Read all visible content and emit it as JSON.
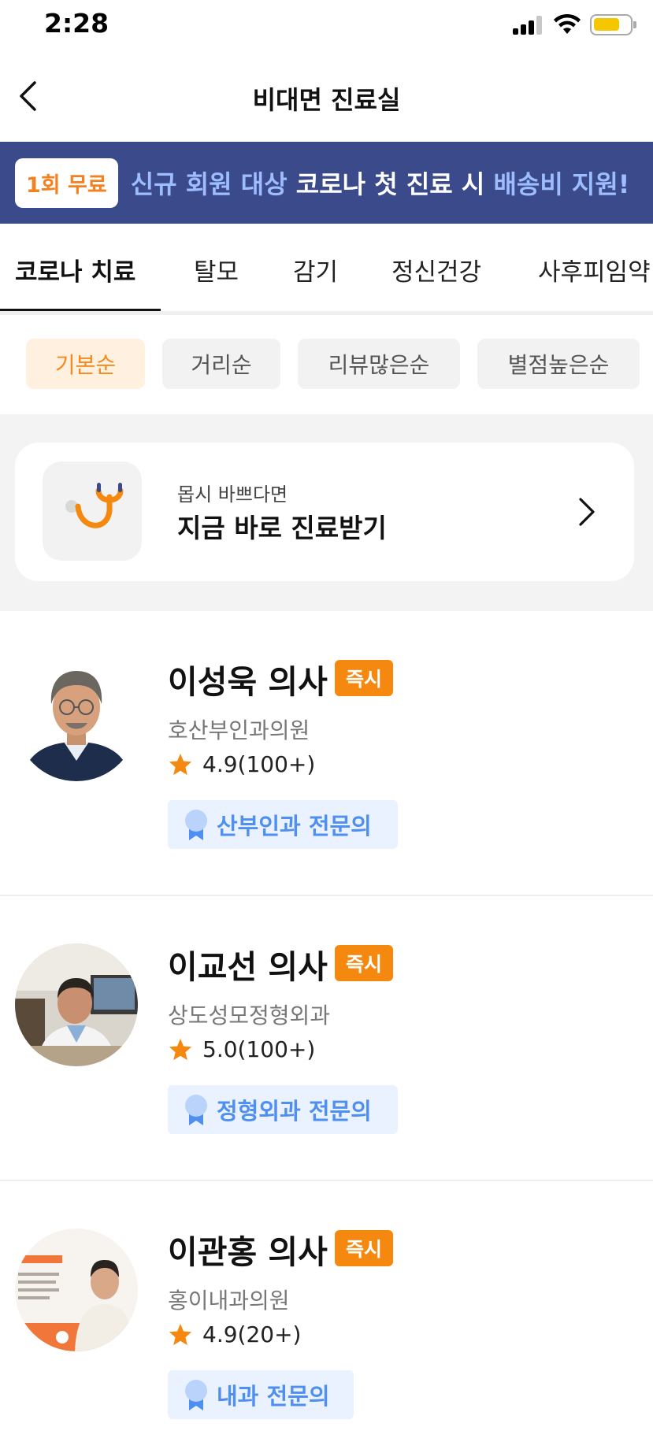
{
  "status_bar": {
    "time": "2:28"
  },
  "header": {
    "title": "비대면 진료실"
  },
  "banner": {
    "badge": "1회 무료",
    "text_part1": "신규 회원 대상 ",
    "text_part2": "코로나 첫 진료 시 ",
    "text_part3": "배송비 지원!"
  },
  "tabs": [
    "코로나 치료",
    "탈모",
    "감기",
    "정신건강",
    "사후피임약"
  ],
  "active_tab": "코로나 치료",
  "sort_options": [
    "기본순",
    "거리순",
    "리뷰많은순",
    "별점높은순"
  ],
  "active_sort": "기본순",
  "quick_consult": {
    "subtitle": "몹시 바쁘다면",
    "title": "지금 바로 진료받기"
  },
  "doctors": [
    {
      "name": "이성욱 의사",
      "badge": "즉시",
      "clinic": "호산부인과의원",
      "rating": "4.9(100+)",
      "specialty": "산부인과 전문의"
    },
    {
      "name": "이교선 의사",
      "badge": "즉시",
      "clinic": "상도성모정형외과",
      "rating": "5.0(100+)",
      "specialty": "정형외과 전문의"
    },
    {
      "name": "이관홍 의사",
      "badge": "즉시",
      "clinic": "홍이내과의원",
      "rating": "4.9(20+)",
      "specialty": "내과 전문의"
    }
  ],
  "colors": {
    "accent": "#f5880f",
    "banner_bg": "#3a4a8a",
    "banner_highlight": "#9dbdff",
    "specialty_text": "#4e8ff0",
    "specialty_bg": "#ebf2ff",
    "active_chip_bg": "#fff0df"
  },
  "icons": {
    "back": "chevron-left-icon",
    "quick": "stethoscope-icon",
    "quick_arrow": "chevron-right-icon",
    "rating": "star-icon",
    "specialty": "medal-icon"
  }
}
